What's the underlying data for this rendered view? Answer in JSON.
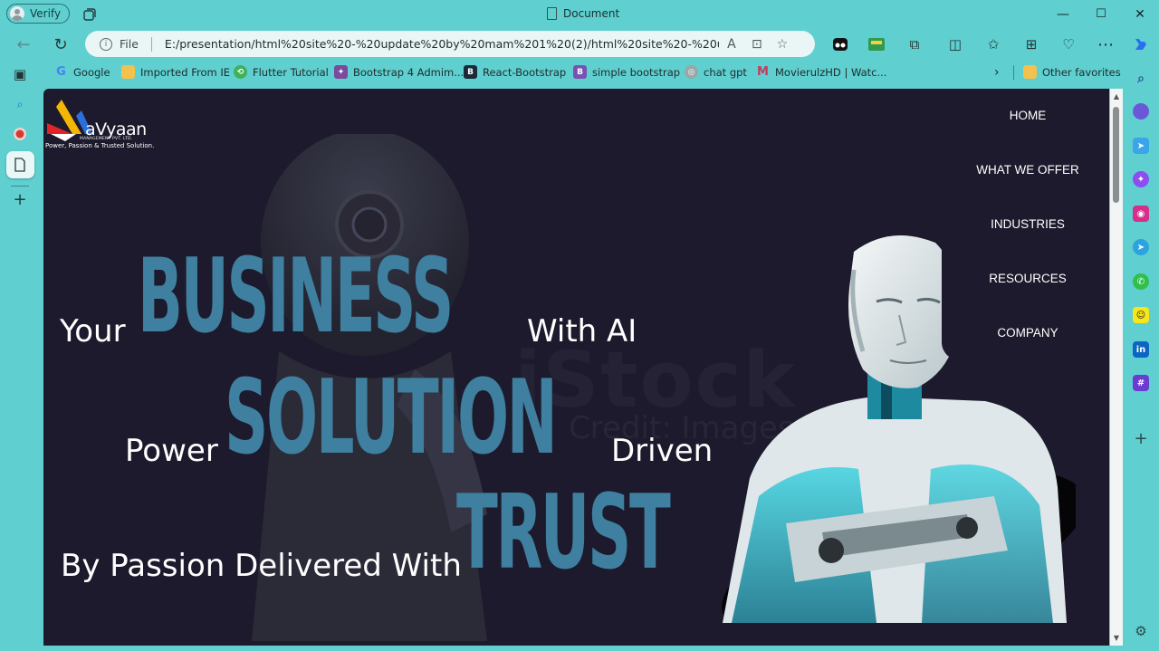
{
  "browser": {
    "profile_label": "Verify",
    "tab_title": "Document",
    "address": {
      "scheme_label": "File",
      "url": "E:/presentation/html%20site%20-%20update%20by%20mam%201%20(2)/html%20site%20-%20update..."
    },
    "window_controls": {
      "minimize": "—",
      "maximize": "☐",
      "close": "✕"
    }
  },
  "bookmarks": [
    {
      "label": "Google",
      "color": "#ffffff"
    },
    {
      "label": "Imported From IE",
      "color": "#f2c14e"
    },
    {
      "label": "Flutter Tutorial",
      "color": "#3fb15a"
    },
    {
      "label": "Bootstrap 4 Admim...",
      "color": "#7a4b9c"
    },
    {
      "label": "React-Bootstrap",
      "color": "#1b2a3a"
    },
    {
      "label": "simple bootstrap",
      "color": "#7952b3"
    },
    {
      "label": "chat gpt",
      "color": "#9aa7a8"
    },
    {
      "label": "MovierulzHD | Watc...",
      "color": "#c23b5c"
    }
  ],
  "other_favorites": "Other favorites",
  "page": {
    "logo": {
      "brand": "aVyaan",
      "subtitle": "MANAGEMENT PVT. LTD.",
      "tagline": "Power, Passion & Trusted Solution."
    },
    "nav": [
      "HOME",
      "WHAT WE OFFER",
      "INDUSTRIES",
      "RESOURCES",
      "COMPANY"
    ],
    "hero": {
      "line1_prefix": "Your",
      "line1_big": "BUSINESS",
      "line1_suffix": "With AI",
      "line2_prefix": "Power",
      "line2_big": "SOLUTION",
      "line2_suffix": "Driven",
      "line3_prefix": "By Passion Delivered With",
      "line3_big": "TRUST"
    },
    "watermark": "iStock",
    "watermark_sub": "Credit: Images"
  },
  "colors": {
    "chrome_bg": "#5fcfcf",
    "page_bg": "#1c1a2c",
    "hero_accent": "#3f7f9f"
  }
}
